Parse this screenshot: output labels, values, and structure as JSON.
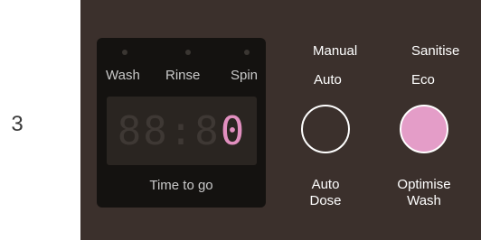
{
  "step_number": "3",
  "display": {
    "cycle_labels": [
      "Wash",
      "Rinse",
      "Spin"
    ],
    "digits_dim": "88:8",
    "digit_lit": "0",
    "time_label": "Time to go"
  },
  "auto_dose": {
    "option_top": "Manual",
    "option_bottom": "Auto",
    "label_line1": "Auto",
    "label_line2": "Dose"
  },
  "optimise_wash": {
    "option_top": "Sanitise",
    "option_bottom": "Eco",
    "label_line1": "Optimise",
    "label_line2": "Wash"
  },
  "colors": {
    "panel": "#3b302c",
    "display": "#141210",
    "accent_pink": "#e49dc8"
  }
}
